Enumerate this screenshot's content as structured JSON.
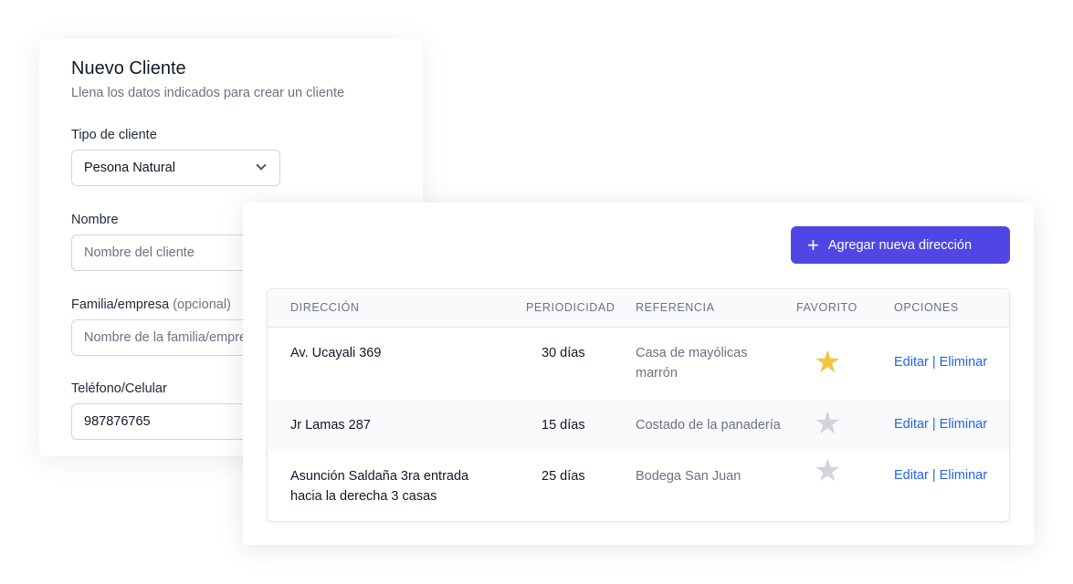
{
  "form": {
    "title": "Nuevo Cliente",
    "subtitle": "Llena los datos indicados para crear un cliente",
    "tipo_label": "Tipo de cliente",
    "tipo_value": "Pesona Natural",
    "nombre_label": "Nombre",
    "nombre_placeholder": "Nombre del cliente",
    "familia_label": "Familia/empresa",
    "familia_optional": "(opcional)",
    "familia_placeholder": "Nombre de la familia/empresa",
    "telefono_label": "Teléfono/Celular",
    "telefono_value": "987876765"
  },
  "addresses": {
    "add_button": "Agregar nueva dirección",
    "headers": [
      "DIRECCIÓN",
      "PERIODICIDAD",
      "REFERENCIA",
      "FAVORITO",
      "OPCIONES"
    ],
    "rows": [
      {
        "direccion": "Av. Ucayali 369",
        "periodicidad": "30 días",
        "referencia": "Casa de mayólicas marrón",
        "favorito": true
      },
      {
        "direccion": "Jr Lamas 287",
        "periodicidad": "15 días",
        "referencia": "Costado de la panadería",
        "favorito": false
      },
      {
        "direccion": "Asunción Saldaña 3ra entrada hacia la derecha 3 casas",
        "periodicidad": "25 días",
        "referencia": "Bodega San Juan",
        "favorito": false
      }
    ],
    "edit_label": "Editar",
    "delete_label": "Eliminar",
    "separator": "|"
  },
  "colors": {
    "accent": "#4f46e5",
    "star_on": "#f5c542",
    "star_off": "#d1d5db",
    "link": "#2563eb"
  }
}
